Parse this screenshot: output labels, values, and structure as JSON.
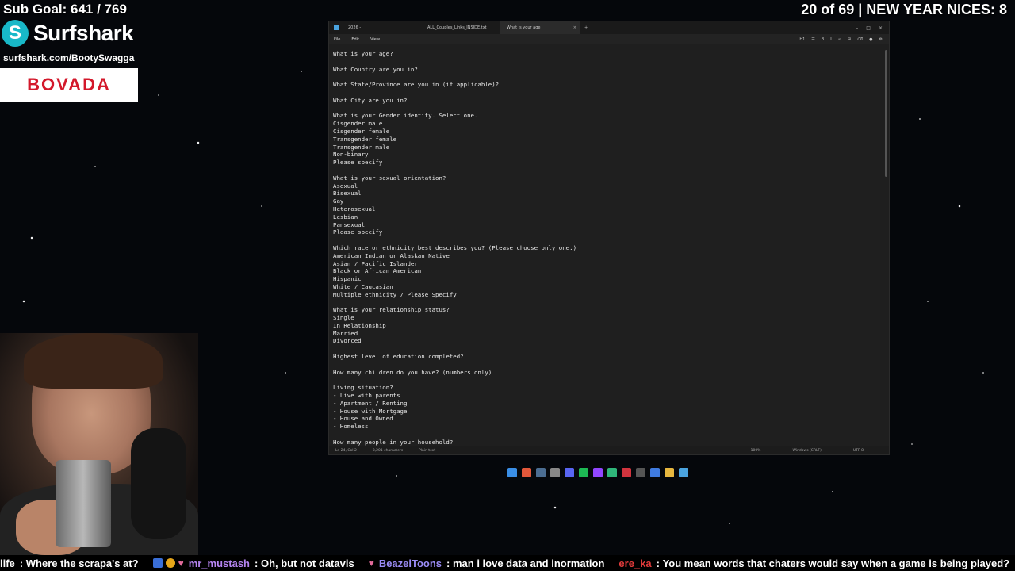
{
  "overlay": {
    "sub_goal": "Sub Goal: 641 / 769",
    "counter": "20 of 69 | NEW YEAR NICES: 8"
  },
  "sponsor": {
    "surfshark_logo_letter": "S",
    "surfshark_name": "Surfshark",
    "surfshark_url": "surfshark.com/BootySwagga",
    "bovada": "BOVADA"
  },
  "editor": {
    "tabs": [
      {
        "label": "2026 -"
      },
      {
        "label": "ALL_Couples_Links_INSIDE.txt"
      },
      {
        "label": "What is your age"
      }
    ],
    "menu": {
      "file": "File",
      "edit": "Edit",
      "view": "View"
    },
    "toolbar": {
      "heading": "H1",
      "bold": "B",
      "italic": "I"
    },
    "lines": [
      "What is your age?",
      "",
      "What Country are you in?",
      "",
      "What State/Province are you in (if applicable)?",
      "",
      "What City are you in?",
      "",
      "What is your Gender identity. Select one.",
      "Cisgender male",
      "Cisgender female",
      "Transgender female",
      "Transgender male",
      "Non-binary",
      "Please specify",
      "",
      "What is your sexual orientation?",
      "Asexual",
      "Bisexual",
      "Gay",
      "Heterosexual",
      "Lesbian",
      "Pansexual",
      "Please specify",
      "",
      "Which race or ethnicity best describes you? (Please choose only one.)",
      "American Indian or Alaskan Native",
      "Asian / Pacific Islander",
      "Black or African American",
      "Hispanic",
      "White / Caucasian",
      "Multiple ethnicity / Please Specify",
      "",
      "What is your relationship status?",
      "Single",
      "In Relationship",
      "Married",
      "Divorced",
      "",
      "Highest level of education completed?",
      "",
      "How many children do you have? (numbers only)",
      "",
      "Living situation?",
      "- Live with parents",
      "- Apartment / Renting",
      "- House with Mortgage",
      "- House and Owned",
      "- Homeless",
      "",
      "How many people in your household?"
    ],
    "status": {
      "position": "Ln 24, Col 2",
      "chars": "3,201 characters",
      "format": "Plain text",
      "zoom": "100%",
      "line_ending": "Windows (CRLF)",
      "encoding": "UTF-8"
    }
  },
  "taskbar_icons": [
    {
      "name": "start-icon",
      "color": "#3a8ee6"
    },
    {
      "name": "firefox-icon",
      "color": "#e2573a"
    },
    {
      "name": "steam-icon",
      "color": "#4b6d92"
    },
    {
      "name": "settings-icon",
      "color": "#888888"
    },
    {
      "name": "discord-icon",
      "color": "#5865f2"
    },
    {
      "name": "spotify-icon",
      "color": "#1db954"
    },
    {
      "name": "twitch-icon",
      "color": "#9146ff"
    },
    {
      "name": "app-green-icon",
      "color": "#2fb67a"
    },
    {
      "name": "obs-icon",
      "color": "#d1343e"
    },
    {
      "name": "app-dark-icon",
      "color": "#555555"
    },
    {
      "name": "vs-icon",
      "color": "#3f7be0"
    },
    {
      "name": "folder-icon",
      "color": "#e7b73f"
    },
    {
      "name": "notepad-icon",
      "color": "#4aa3df"
    }
  ],
  "chat": [
    {
      "user": "life",
      "user_color": "#ffffff",
      "text": "Where the scrapa's at?"
    },
    {
      "user": "mr_mustash",
      "user_color": "#b584f0",
      "text": "Oh, but not datavis"
    },
    {
      "user": "BeazelToons",
      "user_color": "#9b8cf6",
      "text": "man i love data and inormation"
    },
    {
      "user": "ere_ka",
      "user_color": "#e23b3b",
      "text": "You mean words that chaters would say when a game is being played?"
    }
  ]
}
